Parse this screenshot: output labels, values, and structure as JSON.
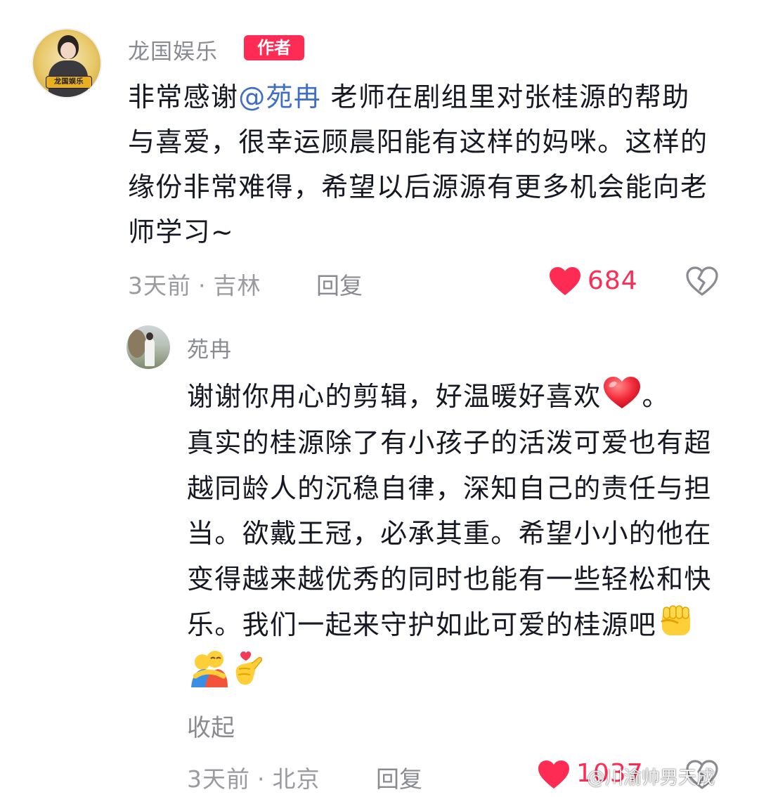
{
  "top_comment": {
    "username": "龙国娱乐",
    "author_tag": "作者",
    "avatar_badge": "龙国娱乐",
    "text_before": "非常感谢",
    "mention": "@苑冉",
    "text_after": " 老师在剧组里对张桂源的帮助与喜爱，很幸运顾晨阳能有这样的妈咪。这样的缘份非常难得，希望以后源源有更多机会能向老师学习~",
    "time": "3天前",
    "location": "吉林",
    "dot": "·",
    "reply_label": "回复",
    "like_count": "684"
  },
  "reply": {
    "username": "苑冉",
    "line1": "谢谢你用心的剪辑，好温暖好喜欢",
    "line1_end": "。",
    "body": "真实的桂源除了有小孩子的活泼可爱也有超越同龄人的沉稳自律，深知自己的责任与担当。欲戴王冠，必承其重。希望小小的他在变得越来越优秀的同时也能有一些轻松和快乐。我们一起来守护如此可爱的桂源吧",
    "expand_label": "收起",
    "time": "3天前",
    "location": "北京",
    "dot": "·",
    "reply_label": "回复",
    "like_count": "1037"
  },
  "icons": {
    "like": "heart-icon",
    "dislike": "broken-heart-icon",
    "emoji_heart": "red-heart-emoji",
    "emoji_fist": "raised-fist-emoji",
    "emoji_hug": "hugging-people-emoji",
    "emoji_finger_heart": "finger-heart-emoji"
  },
  "colors": {
    "accent": "#fe2c55",
    "mention": "#3f6fc5",
    "meta": "#9a9ba0"
  },
  "watermark": "@川渝帅男天成"
}
